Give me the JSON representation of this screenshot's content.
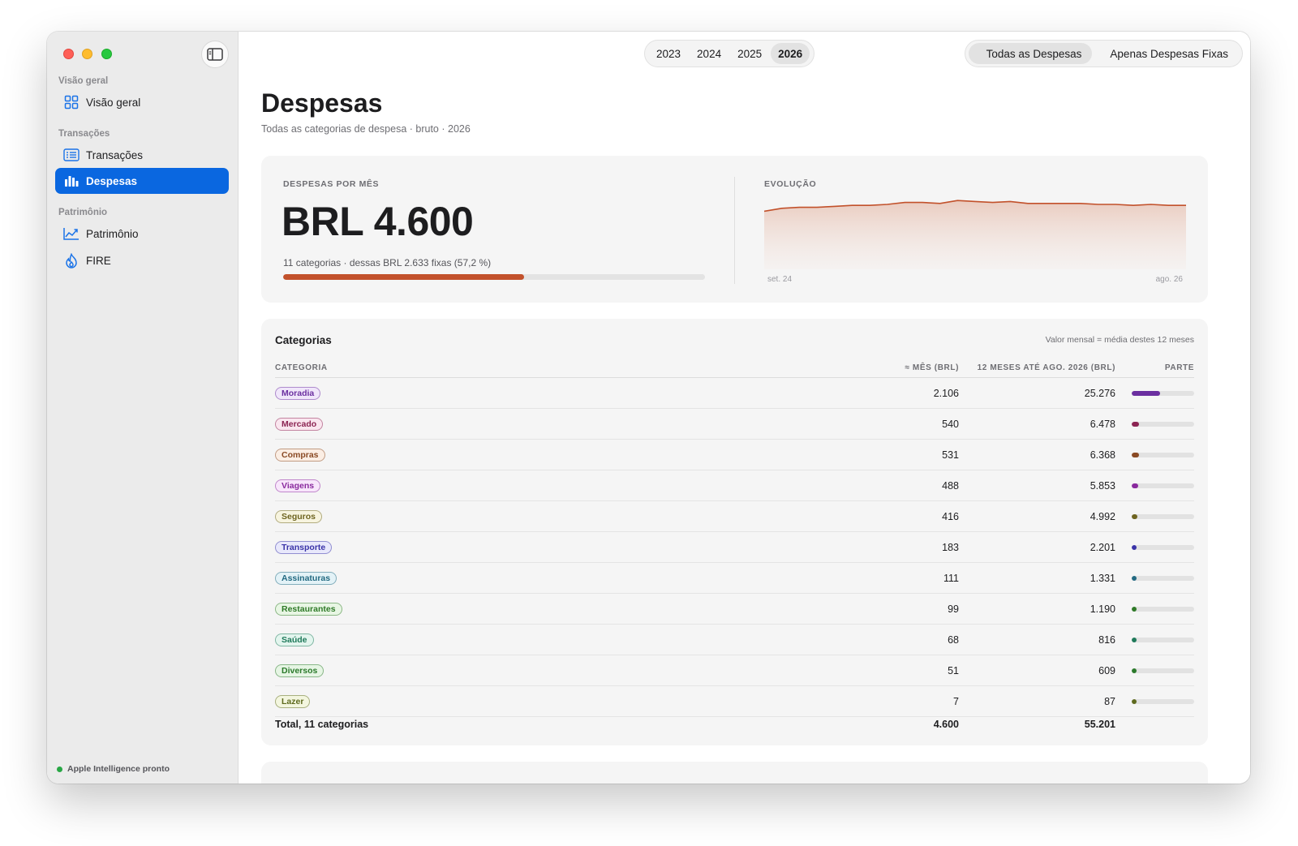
{
  "sidebar": {
    "sections": [
      {
        "title": "Visão geral",
        "items": [
          {
            "label": "Visão geral",
            "icon": "grid-icon",
            "active": false
          }
        ]
      },
      {
        "title": "Transações",
        "items": [
          {
            "label": "Transações",
            "icon": "list-icon",
            "active": false
          }
        ]
      },
      {
        "title": "Despesas",
        "items": [
          {
            "label": "Despesas",
            "icon": "bar-chart-icon",
            "active": true
          }
        ]
      },
      {
        "title": "Patrimônio",
        "items": [
          {
            "label": "Patrimônio",
            "icon": "trend-icon",
            "active": false
          },
          {
            "label": "FIRE",
            "icon": "flame-icon",
            "active": false
          }
        ]
      }
    ],
    "status": "Apple Intelligence pronto"
  },
  "toolbar": {
    "years": [
      "2023",
      "2024",
      "2025",
      "2026"
    ],
    "active_year": "2026",
    "filters": [
      "Todas as Despesas",
      "Apenas Despesas Fixas"
    ],
    "active_filter": "Todas as Despesas"
  },
  "page": {
    "title": "Despesas",
    "subtitle": "Todas as categorias de despesa · bruto · 2026"
  },
  "summary": {
    "label": "DESPESAS POR MÊS",
    "value": "BRL 4.600",
    "note": "11 categorias · dessas BRL 2.633 fixas (57,2 %)",
    "fixed_share": 0.572,
    "bar_color": "#c2512b"
  },
  "evolution": {
    "label": "EVOLUÇÃO",
    "start_label": "set. 24",
    "end_label": "ago. 26",
    "line_color": "#c2512b",
    "series_relative": [
      0.83,
      0.86,
      0.87,
      0.87,
      0.88,
      0.89,
      0.89,
      0.9,
      0.92,
      0.92,
      0.91,
      0.94,
      0.93,
      0.92,
      0.93,
      0.91,
      0.91,
      0.91,
      0.91,
      0.9,
      0.9,
      0.89,
      0.9,
      0.89,
      0.89
    ]
  },
  "categories_table": {
    "title": "Categorias",
    "note": "Valor mensal = média destes 12 meses",
    "columns": [
      "CATEGORIA",
      "≈ MÊS (BRL)",
      "12 MESES ATÉ AGO. 2026 (BRL)",
      "PARTE"
    ],
    "rows": [
      {
        "name": "Moradia",
        "mes": "2.106",
        "ano": "25.276",
        "share": 0.458,
        "color": "#6b2fa0",
        "bg": "#f0e6fa"
      },
      {
        "name": "Mercado",
        "mes": "540",
        "ano": "6.478",
        "share": 0.117,
        "color": "#8c2453",
        "bg": "#fae6ef"
      },
      {
        "name": "Compras",
        "mes": "531",
        "ano": "6.368",
        "share": 0.115,
        "color": "#8a4a24",
        "bg": "#fbeee4"
      },
      {
        "name": "Viagens",
        "mes": "488",
        "ano": "5.853",
        "share": 0.106,
        "color": "#8a2a9e",
        "bg": "#f8e6fb"
      },
      {
        "name": "Seguros",
        "mes": "416",
        "ano": "4.992",
        "share": 0.09,
        "color": "#6e6420",
        "bg": "#f7f4df"
      },
      {
        "name": "Transporte",
        "mes": "183",
        "ano": "2.201",
        "share": 0.04,
        "color": "#3a33a8",
        "bg": "#e8e8fb"
      },
      {
        "name": "Assinaturas",
        "mes": "111",
        "ano": "1.331",
        "share": 0.024,
        "color": "#236a82",
        "bg": "#e3f2f7"
      },
      {
        "name": "Restaurantes",
        "mes": "99",
        "ano": "1.190",
        "share": 0.022,
        "color": "#2f7a28",
        "bg": "#e8f6e4"
      },
      {
        "name": "Saúde",
        "mes": "68",
        "ano": "816",
        "share": 0.015,
        "color": "#1f7a5a",
        "bg": "#e3f5ee"
      },
      {
        "name": "Diversos",
        "mes": "51",
        "ano": "609",
        "share": 0.011,
        "color": "#2b7a2b",
        "bg": "#e6f5e4"
      },
      {
        "name": "Lazer",
        "mes": "7",
        "ano": "87",
        "share": 0.002,
        "color": "#5e6a1e",
        "bg": "#f3f6df"
      }
    ],
    "total": {
      "label": "Total, 11 categorias",
      "mes": "4.600",
      "ano": "55.201"
    }
  }
}
